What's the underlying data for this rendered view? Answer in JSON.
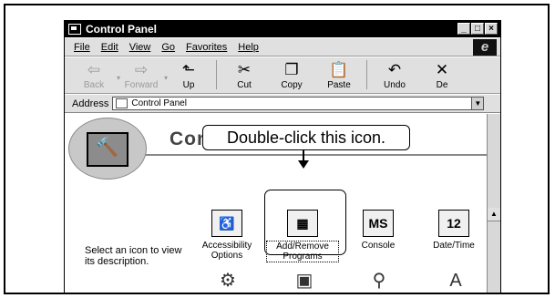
{
  "window": {
    "title": "Control Panel"
  },
  "menu": [
    "File",
    "Edit",
    "View",
    "Go",
    "Favorites",
    "Help"
  ],
  "toolbar": [
    {
      "label": "Back",
      "glyph": "⇦",
      "disabled": true,
      "drop": true
    },
    {
      "label": "Forward",
      "glyph": "⇨",
      "disabled": true,
      "drop": true
    },
    {
      "label": "Up",
      "glyph": "⬑",
      "disabled": false
    },
    {
      "label": "Cut",
      "glyph": "✂",
      "disabled": false
    },
    {
      "label": "Copy",
      "glyph": "❐",
      "disabled": false
    },
    {
      "label": "Paste",
      "glyph": "📋",
      "disabled": false
    },
    {
      "label": "Undo",
      "glyph": "↶",
      "disabled": false
    },
    {
      "label": "De",
      "glyph": "✕",
      "disabled": false
    }
  ],
  "address": {
    "label": "Address",
    "value": "Control Panel"
  },
  "content": {
    "heading": "Control Panel",
    "description": "Select an icon to view its description."
  },
  "icons": [
    {
      "label": "Accessibility Options",
      "glyph": "♿"
    },
    {
      "label": "Add/Remove Programs",
      "glyph": "▦"
    },
    {
      "label": "Console",
      "glyph": "MS"
    },
    {
      "label": "Date/Time",
      "glyph": "12"
    }
  ],
  "callout": {
    "text": "Double-click this icon."
  }
}
